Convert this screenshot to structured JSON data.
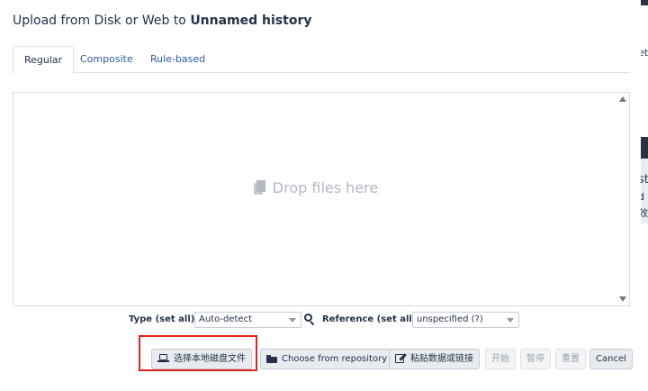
{
  "modal": {
    "title_prefix": "Upload from Disk or Web to ",
    "history_name": "Unnamed history"
  },
  "tabs": [
    {
      "label": "Regular",
      "active": true
    },
    {
      "label": "Composite",
      "active": false
    },
    {
      "label": "Rule-based",
      "active": false
    }
  ],
  "dropzone": {
    "label": "Drop files here",
    "icon": "copy-icon"
  },
  "settings": {
    "type_label": "Type (set all):",
    "type_value": "Auto-detect",
    "reference_label": "Reference (set all):",
    "reference_value": "unspecified (?)"
  },
  "buttons": {
    "local": "选择本地磁盘文件",
    "repository": "Choose from repository",
    "paste": "粘贴数据或链接",
    "start": "开始",
    "pause": "暂停",
    "reset": "重置",
    "cancel": "Cancel"
  },
  "background": {
    "frag1": "et",
    "frag2": "st",
    "frag3": "d",
    "frag4": "效"
  },
  "colors": {
    "link": "#2c5aa0",
    "text": "#25324a",
    "highlight": "#e8221b",
    "backdrop": "#4a5468"
  }
}
